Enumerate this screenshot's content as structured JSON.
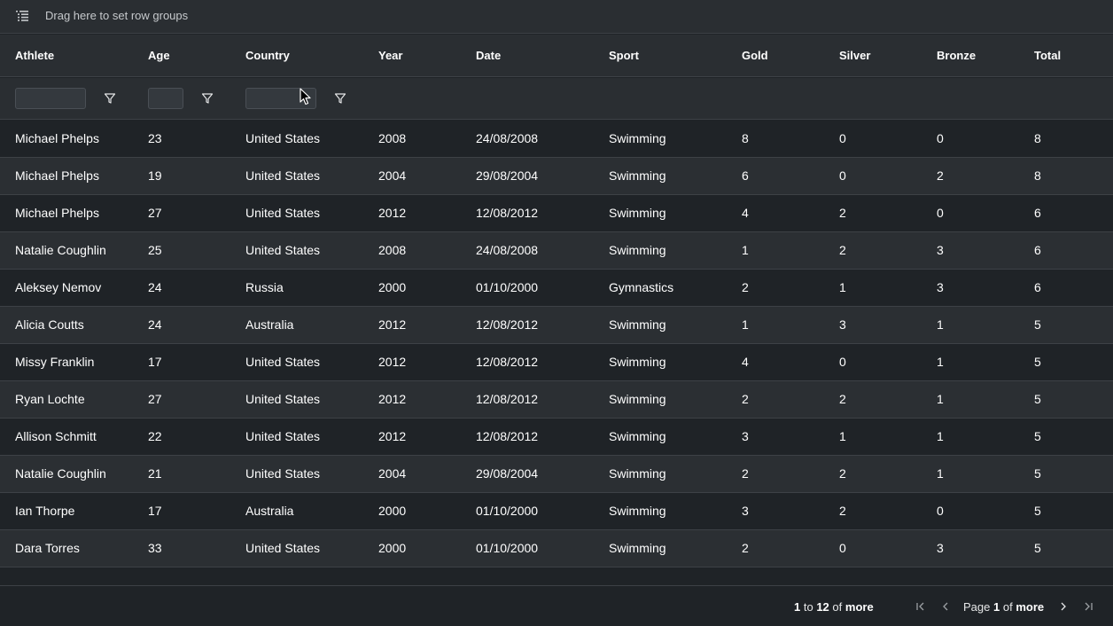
{
  "group_panel": {
    "text": "Drag here to set row groups",
    "icon": "row-group-icon"
  },
  "columns": [
    {
      "key": "athlete",
      "label": "Athlete"
    },
    {
      "key": "age",
      "label": "Age"
    },
    {
      "key": "country",
      "label": "Country"
    },
    {
      "key": "year",
      "label": "Year"
    },
    {
      "key": "date",
      "label": "Date"
    },
    {
      "key": "sport",
      "label": "Sport"
    },
    {
      "key": "gold",
      "label": "Gold"
    },
    {
      "key": "silver",
      "label": "Silver"
    },
    {
      "key": "bronze",
      "label": "Bronze"
    },
    {
      "key": "total",
      "label": "Total"
    }
  ],
  "filters": {
    "athlete": {
      "value": "",
      "placeholder": ""
    },
    "age": {
      "value": "",
      "placeholder": ""
    },
    "country": {
      "value": "",
      "placeholder": ""
    }
  },
  "rows": [
    {
      "athlete": "Michael Phelps",
      "age": "23",
      "country": "United States",
      "year": "2008",
      "date": "24/08/2008",
      "sport": "Swimming",
      "gold": "8",
      "silver": "0",
      "bronze": "0",
      "total": "8"
    },
    {
      "athlete": "Michael Phelps",
      "age": "19",
      "country": "United States",
      "year": "2004",
      "date": "29/08/2004",
      "sport": "Swimming",
      "gold": "6",
      "silver": "0",
      "bronze": "2",
      "total": "8"
    },
    {
      "athlete": "Michael Phelps",
      "age": "27",
      "country": "United States",
      "year": "2012",
      "date": "12/08/2012",
      "sport": "Swimming",
      "gold": "4",
      "silver": "2",
      "bronze": "0",
      "total": "6"
    },
    {
      "athlete": "Natalie Coughlin",
      "age": "25",
      "country": "United States",
      "year": "2008",
      "date": "24/08/2008",
      "sport": "Swimming",
      "gold": "1",
      "silver": "2",
      "bronze": "3",
      "total": "6"
    },
    {
      "athlete": "Aleksey Nemov",
      "age": "24",
      "country": "Russia",
      "year": "2000",
      "date": "01/10/2000",
      "sport": "Gymnastics",
      "gold": "2",
      "silver": "1",
      "bronze": "3",
      "total": "6"
    },
    {
      "athlete": "Alicia Coutts",
      "age": "24",
      "country": "Australia",
      "year": "2012",
      "date": "12/08/2012",
      "sport": "Swimming",
      "gold": "1",
      "silver": "3",
      "bronze": "1",
      "total": "5"
    },
    {
      "athlete": "Missy Franklin",
      "age": "17",
      "country": "United States",
      "year": "2012",
      "date": "12/08/2012",
      "sport": "Swimming",
      "gold": "4",
      "silver": "0",
      "bronze": "1",
      "total": "5"
    },
    {
      "athlete": "Ryan Lochte",
      "age": "27",
      "country": "United States",
      "year": "2012",
      "date": "12/08/2012",
      "sport": "Swimming",
      "gold": "2",
      "silver": "2",
      "bronze": "1",
      "total": "5"
    },
    {
      "athlete": "Allison Schmitt",
      "age": "22",
      "country": "United States",
      "year": "2012",
      "date": "12/08/2012",
      "sport": "Swimming",
      "gold": "3",
      "silver": "1",
      "bronze": "1",
      "total": "5"
    },
    {
      "athlete": "Natalie Coughlin",
      "age": "21",
      "country": "United States",
      "year": "2004",
      "date": "29/08/2004",
      "sport": "Swimming",
      "gold": "2",
      "silver": "2",
      "bronze": "1",
      "total": "5"
    },
    {
      "athlete": "Ian Thorpe",
      "age": "17",
      "country": "Australia",
      "year": "2000",
      "date": "01/10/2000",
      "sport": "Swimming",
      "gold": "3",
      "silver": "2",
      "bronze": "0",
      "total": "5"
    },
    {
      "athlete": "Dara Torres",
      "age": "33",
      "country": "United States",
      "year": "2000",
      "date": "01/10/2000",
      "sport": "Swimming",
      "gold": "2",
      "silver": "0",
      "bronze": "3",
      "total": "5"
    }
  ],
  "footer": {
    "summary_from": "1",
    "summary_to_word": "to",
    "summary_to": "12",
    "summary_of_word": "of",
    "summary_total": "more",
    "page_word": "Page",
    "page_current": "1",
    "page_of_word": "of",
    "page_total": "more"
  },
  "colors": {
    "background": "#1f2327",
    "header_background": "#2a2e32",
    "odd_row": "#2b2f33",
    "border": "#3d4146"
  }
}
